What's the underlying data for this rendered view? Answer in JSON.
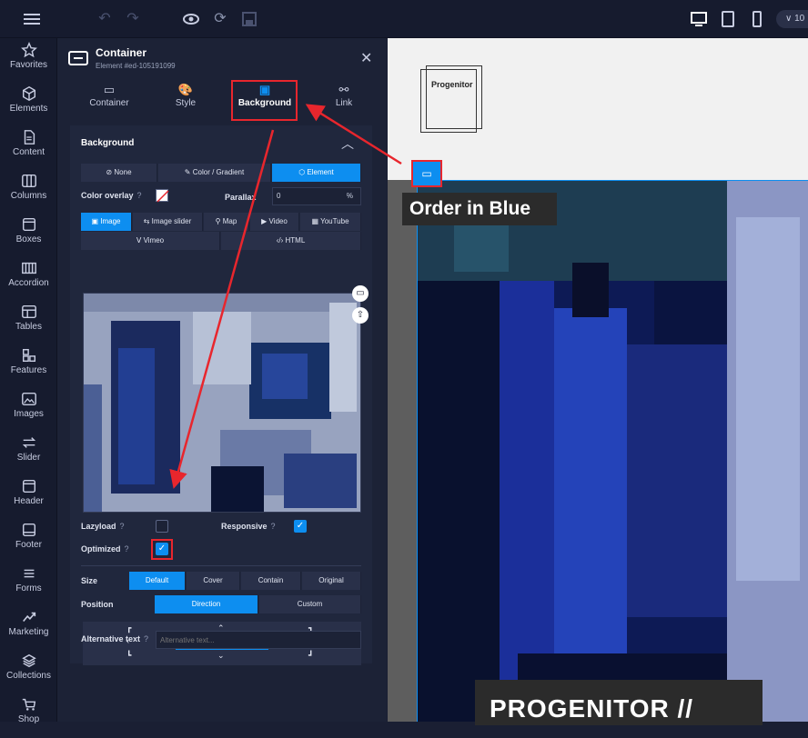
{
  "topbar": {
    "zoom_label": "∨ 10",
    "icons": [
      "menu-icon",
      "undo-icon",
      "redo-icon",
      "eye-icon",
      "refresh-icon",
      "save-icon",
      "desktop-icon",
      "tablet-icon",
      "mobile-icon"
    ]
  },
  "nav": {
    "items": [
      {
        "label": "Favorites",
        "icon": "star-icon"
      },
      {
        "label": "Elements",
        "icon": "cube-icon"
      },
      {
        "label": "Content",
        "icon": "document-icon"
      },
      {
        "label": "Columns",
        "icon": "columns-icon"
      },
      {
        "label": "Boxes",
        "icon": "box-icon"
      },
      {
        "label": "Accordion",
        "icon": "accordion-icon"
      },
      {
        "label": "Tables",
        "icon": "table-icon"
      },
      {
        "label": "Features",
        "icon": "features-icon"
      },
      {
        "label": "Images",
        "icon": "image-icon"
      },
      {
        "label": "Slider",
        "icon": "slider-icon"
      },
      {
        "label": "Header",
        "icon": "header-icon"
      },
      {
        "label": "Footer",
        "icon": "footer-icon"
      },
      {
        "label": "Forms",
        "icon": "forms-icon"
      },
      {
        "label": "Marketing",
        "icon": "marketing-icon"
      },
      {
        "label": "Collections",
        "icon": "collections-icon"
      },
      {
        "label": "Shop",
        "icon": "cart-icon"
      }
    ]
  },
  "panel": {
    "title": "Container",
    "subtitle": "Element #ed-105191099",
    "tabs": [
      "Container",
      "Style",
      "Background",
      "Link"
    ],
    "active_tab": "Background",
    "section_title": "Background",
    "bg_types": [
      "None",
      "Color / Gradient",
      "Element"
    ],
    "color_overlay_label": "Color overlay",
    "parallax_label": "Parallax",
    "parallax_value": "0",
    "parallax_unit": "%",
    "media_types_row1": [
      "Image",
      "Image slider",
      "Map",
      "Video",
      "YouTube"
    ],
    "media_types_row2": [
      "Vimeo",
      "HTML"
    ],
    "lazyload_label": "Lazyload",
    "responsive_label": "Responsive",
    "optimized_label": "Optimized",
    "lazyload": false,
    "responsive": true,
    "optimized": true,
    "size_label": "Size",
    "size_options": [
      "Default",
      "Cover",
      "Contain",
      "Original"
    ],
    "size_selected": "Default",
    "position_label": "Position",
    "position_options": [
      "Direction",
      "Custom"
    ],
    "position_selected": "Direction",
    "alt_label": "Alternative text",
    "alt_placeholder": "Alternative text..."
  },
  "canvas": {
    "logo_text": "Progenitor",
    "section_label": "Order in Blue",
    "hero_text": "PROGENITOR //"
  },
  "colors": {
    "accent": "#0d8ef0",
    "highlight": "#e8262d",
    "panel_bg": "#1c2236"
  }
}
